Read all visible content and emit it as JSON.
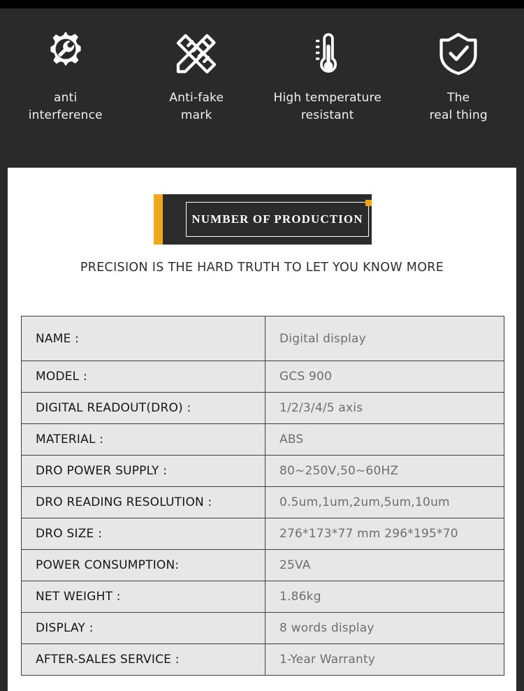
{
  "header": {
    "features": [
      {
        "icon": "gear-wrench-icon",
        "label": "anti\ninterference"
      },
      {
        "icon": "pencil-ruler-icon",
        "label": "Anti-fake\nmark"
      },
      {
        "icon": "thermometer-icon",
        "label": "High temperature\nresistant"
      },
      {
        "icon": "shield-check-icon",
        "label": "The\nreal thing"
      }
    ]
  },
  "banner": {
    "title": "NUMBER OF PRODUCTION",
    "accent_color": "#f0a81e",
    "box_color": "#2b2b2b",
    "dot_color": "#e7a719"
  },
  "subtitle": "PRECISION IS THE HARD TRUTH TO LET YOU KNOW MORE",
  "spec_table": {
    "rows": [
      {
        "label": "NAME :",
        "value": "Digital display"
      },
      {
        "label": "MODEL :",
        "value": "GCS 900"
      },
      {
        "label": "DIGITAL READOUT(DRO) :",
        "value": "1/2/3/4/5 axis"
      },
      {
        "label": "MATERIAL :",
        "value": "ABS"
      },
      {
        "label": "DRO POWER SUPPLY :",
        "value": "80~250V,50~60HZ"
      },
      {
        "label": "DRO READING RESOLUTION :",
        "value": "0.5um,1um,2um,5um,10um"
      },
      {
        "label": "DRO SIZE :",
        "value": "276*173*77 mm 296*195*70"
      },
      {
        "label": "POWER CONSUMPTION:",
        "value": "25VA"
      },
      {
        "label": "NET WEIGHT :",
        "value": "1.86kg"
      },
      {
        "label": "DISPLAY :",
        "value": "8 words display"
      },
      {
        "label": "AFTER-SALES SERVICE :",
        "value": "1-Year Warranty"
      }
    ]
  }
}
